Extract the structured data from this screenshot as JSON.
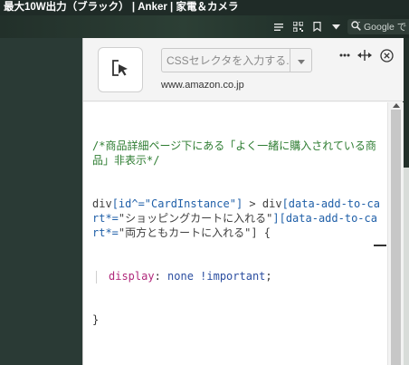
{
  "browser": {
    "page_title": "最大10W出力（ブラック） | Anker | 家電＆カメラ",
    "search_hint": "Google で"
  },
  "toolbar": {
    "icons": [
      "reading-list-icon",
      "qr-code-icon",
      "bookmark-icon",
      "dropdown-arrow-icon",
      "search-icon"
    ]
  },
  "panel": {
    "selector_placeholder": "CSSセレクタを入力する...",
    "site": "www.amazon.co.jp",
    "more_label": "•••"
  },
  "code": {
    "comment": "/*商品詳細ページ下にある「よく一緒に購入されている商品」非表示*/",
    "sel_tag1": "div",
    "sel_attr1": "[id^=\"CardInstance\"]",
    "sel_combinator": " > ",
    "sel_tag2": "div",
    "sel_attr2_key": "[data-add-to-cart*=",
    "sel_attr2_val": "\"ショッピングカートに入れる\"",
    "sel_attr2_end": "]",
    "sel_attr3_key": "[data-add-to-cart*=",
    "sel_attr3_val": "\"両方ともカートに入れる\"",
    "sel_attr3_end": "] {",
    "prop": "display",
    "colon": ": ",
    "value": "none !important",
    "semi": ";",
    "close": "}"
  }
}
